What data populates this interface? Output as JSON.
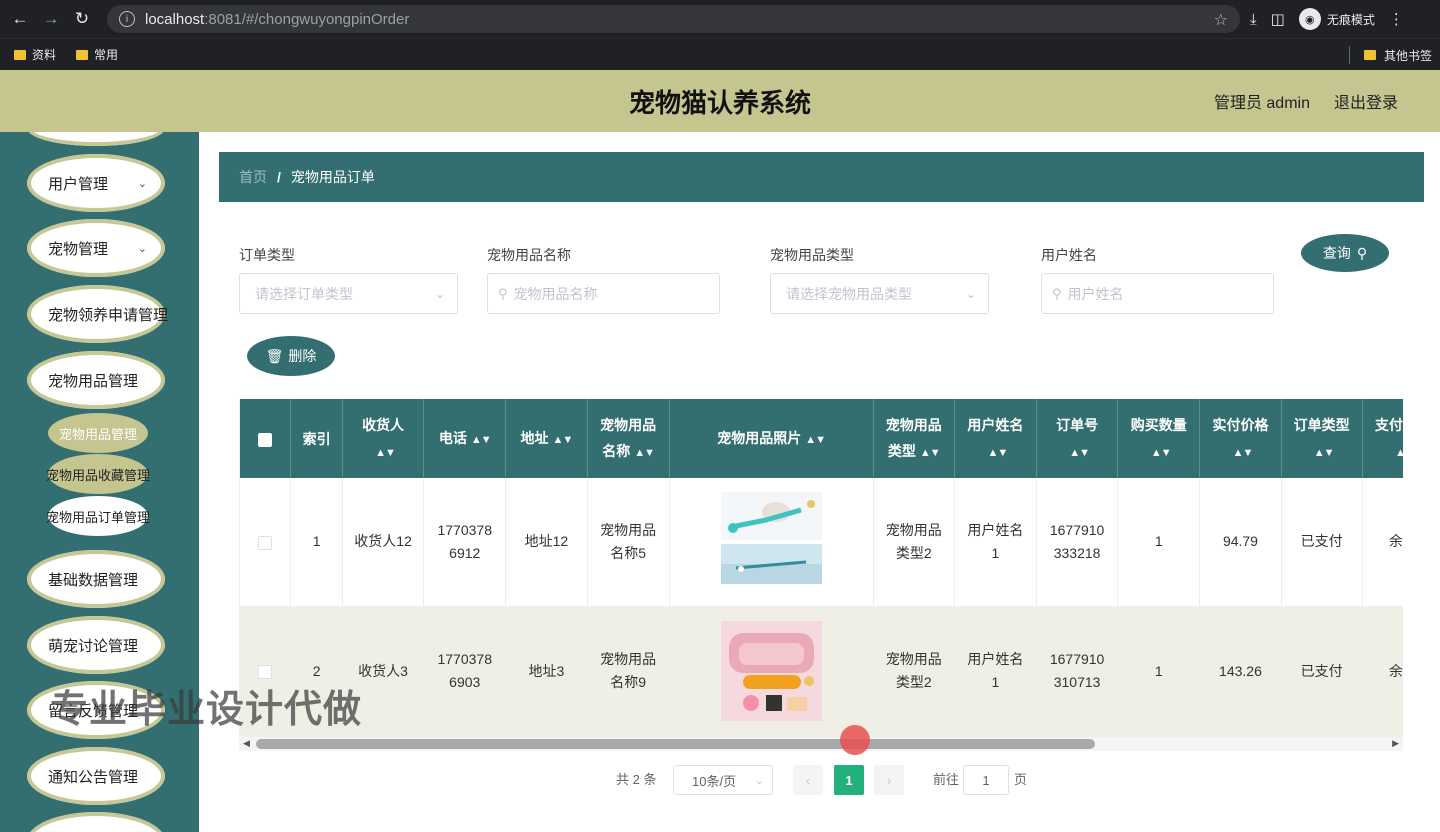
{
  "browser": {
    "url_host": "localhost",
    "url_path": ":8081/#/chongwuyongpinOrder",
    "incognito_label": "无痕模式",
    "bookmarks": [
      "资料",
      "常用"
    ],
    "other_bookmarks": "其他书签"
  },
  "header": {
    "title": "宠物猫认养系统",
    "user": "管理员 admin",
    "logout": "退出登录"
  },
  "sidebar": {
    "items": [
      {
        "label": "用户管理"
      },
      {
        "label": "宠物管理"
      },
      {
        "label": "宠物领养申请管理"
      },
      {
        "label": "宠物用品管理"
      },
      {
        "label": "基础数据管理"
      },
      {
        "label": "萌宠讨论管理"
      },
      {
        "label": "留言反馈管理"
      },
      {
        "label": "通知公告管理"
      }
    ],
    "subitems": [
      {
        "label": "宠物用品管理"
      },
      {
        "label": "宠物用品收藏管理"
      },
      {
        "label": "宠物用品订单管理"
      }
    ]
  },
  "breadcrumb": {
    "home": "首页",
    "separator": "/",
    "current": "宠物用品订单"
  },
  "filters": {
    "order_type": {
      "label": "订单类型",
      "placeholder": "请选择订单类型"
    },
    "product_name": {
      "label": "宠物用品名称",
      "placeholder": "宠物用品名称"
    },
    "product_type": {
      "label": "宠物用品类型",
      "placeholder": "请选择宠物用品类型"
    },
    "user_name": {
      "label": "用户姓名",
      "placeholder": "用户姓名"
    },
    "query_button": "查询",
    "delete_button": "删除"
  },
  "table": {
    "headers": {
      "index": "索引",
      "receiver": "收货人",
      "phone": "电话",
      "address": "地址",
      "name_l1": "宠物用品",
      "name_l2": "名称",
      "photo": "宠物用品照片",
      "type_l1": "宠物用品",
      "type_l2": "类型",
      "user": "用户姓名",
      "order_no": "订单号",
      "qty": "购买数量",
      "price": "实付价格",
      "order_type": "订单类型",
      "pay_type": "支付类型"
    },
    "rows": [
      {
        "index": "1",
        "receiver": "收货人12",
        "phone_l1": "1770378",
        "phone_l2": "6912",
        "address": "地址12",
        "name_l1": "宠物用品",
        "name_l2": "名称5",
        "type_l1": "宠物用品",
        "type_l2": "类型2",
        "user_l1": "用户姓名",
        "user_l2": "1",
        "order_l1": "1677910",
        "order_l2": "333218",
        "qty": "1",
        "price": "94.79",
        "order_type": "已支付",
        "pay_type": "余额"
      },
      {
        "index": "2",
        "receiver": "收货人3",
        "phone_l1": "1770378",
        "phone_l2": "6903",
        "address": "地址3",
        "name_l1": "宠物用品",
        "name_l2": "名称9",
        "type_l1": "宠物用品",
        "type_l2": "类型2",
        "user_l1": "用户姓名",
        "user_l2": "1",
        "order_l1": "1677910",
        "order_l2": "310713",
        "qty": "1",
        "price": "143.26",
        "order_type": "已支付",
        "pay_type": "余额"
      }
    ]
  },
  "pagination": {
    "total": "共 2 条",
    "page_size": "10条/页",
    "prev": "‹",
    "current": "1",
    "next": "›",
    "goto_prefix": "前往",
    "goto_value": "1",
    "goto_suffix": "页"
  },
  "watermark": "专业毕业设计代做"
}
